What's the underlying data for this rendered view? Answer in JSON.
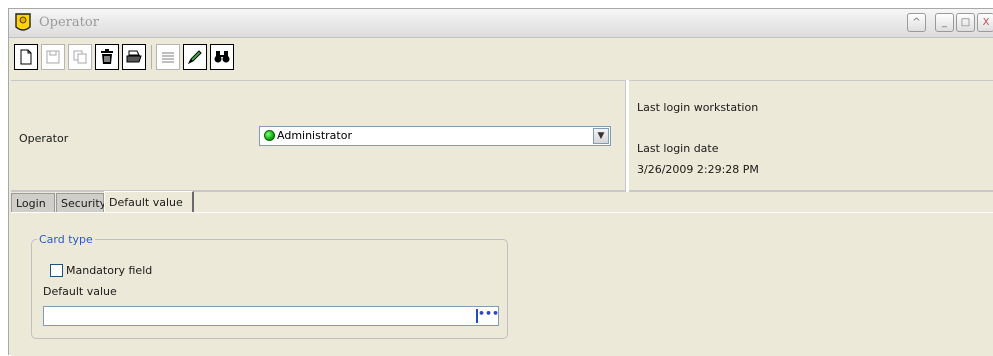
{
  "window": {
    "title": "Operator",
    "controls": [
      "^",
      "_",
      "□",
      "X"
    ]
  },
  "toolbar": {
    "buttons": [
      {
        "name": "new-icon",
        "enabled": true
      },
      {
        "name": "save-icon",
        "enabled": false
      },
      {
        "name": "copy-icon",
        "enabled": false
      },
      {
        "name": "trash-icon",
        "enabled": true
      },
      {
        "name": "print-icon",
        "enabled": true
      },
      {
        "name": "list-icon",
        "enabled": false
      },
      {
        "name": "pen-icon",
        "enabled": true
      },
      {
        "name": "binoculars-icon",
        "enabled": true
      }
    ]
  },
  "header": {
    "operator_label": "Operator",
    "operator_value": "Administrator",
    "operator_status_color": "#0cb10c",
    "last_login_workstation_label": "Last login workstation",
    "last_login_workstation_value": "",
    "last_login_date_label": "Last login date",
    "last_login_date_value": "3/26/2009 2:29:28 PM"
  },
  "tabs": [
    {
      "label": "Login",
      "active": false
    },
    {
      "label": "Security",
      "active": false
    },
    {
      "label": "Default value",
      "active": true
    }
  ],
  "default_value_tab": {
    "group_title": "Card type",
    "mandatory_label": "Mandatory field",
    "mandatory_checked": false,
    "default_value_label": "Default value",
    "default_value": "",
    "browse_button": "•••"
  },
  "colors": {
    "accent": "#2a5aca",
    "window_bg": "#ece9d8"
  }
}
